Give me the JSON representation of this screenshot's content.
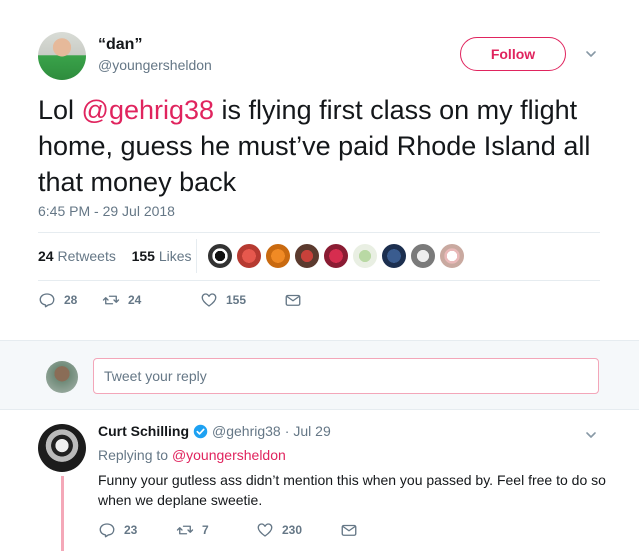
{
  "main_tweet": {
    "display_name": "“dan”",
    "handle": "@youngersheldon",
    "follow_label": "Follow",
    "text_before": "Lol ",
    "mention": "@gehrig38",
    "text_after": " is flying first class on my flight home, guess he must’ve paid Rhode Island all that money back",
    "timestamp": "6:45 PM - 29 Jul 2018",
    "retweet_count": "24",
    "retweet_label": "Retweets",
    "like_count": "155",
    "like_label": "Likes",
    "actions": {
      "reply_count": "28",
      "retweet_count": "24",
      "like_count": "155"
    }
  },
  "reply_box": {
    "placeholder": "Tweet your reply"
  },
  "reply_tweet": {
    "display_name": "Curt Schilling",
    "handle": "@gehrig38",
    "separator": "·",
    "date": "Jul 29",
    "replying_to_label": "Replying to",
    "replying_to_handle": "@youngersheldon",
    "text": "Funny your gutless ass didn’t mention this when you passed by. Feel free to do so when we deplane sweetie.",
    "actions": {
      "reply_count": "23",
      "retweet_count": "7",
      "like_count": "230"
    }
  },
  "colors": {
    "accent": "#e0245e",
    "secondary_text": "#657786",
    "primary_text": "#14171a",
    "verified": "#1da1f2"
  }
}
